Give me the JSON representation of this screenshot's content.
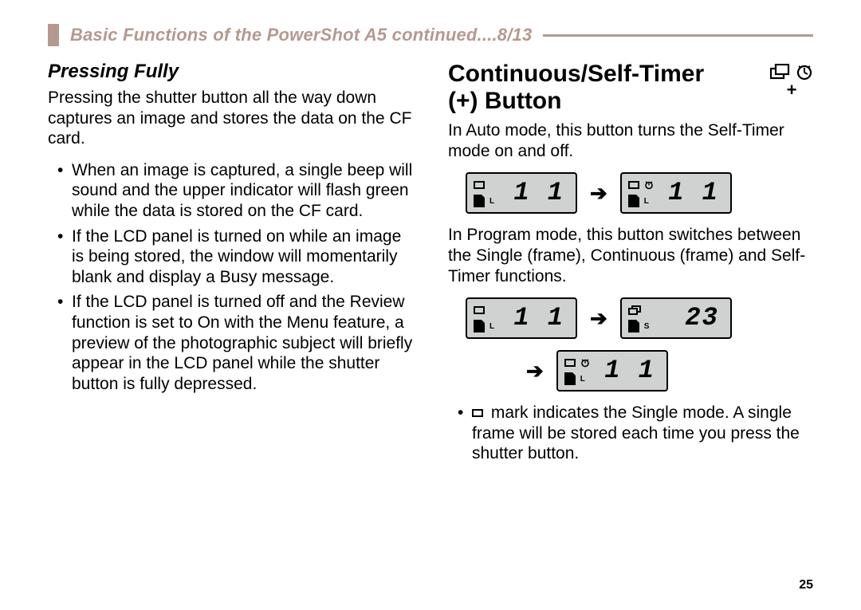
{
  "header": {
    "title": "Basic Functions of the PowerShot A5  continued....8/13"
  },
  "left": {
    "subhead": "Pressing Fully",
    "intro": "Pressing the shutter button all the way down captures an image and stores the data on the CF card.",
    "bullets": [
      "When an image is captured, a single beep will sound and the upper indicator will flash green while the data is stored on the CF card.",
      "If the LCD panel is turned on while an image is being stored, the window will momentarily blank and display a Busy message.",
      "If the LCD panel is turned off and the Review function is set to On with the Menu feature, a preview of the photographic subject will briefly appear in the LCD panel while the shutter button is fully depressed."
    ]
  },
  "right": {
    "title_line1": "Continuous/Self-Timer",
    "title_line2": "(+) Button",
    "plus": "+",
    "p1": "In Auto mode, this button turns the Self-Timer mode on and off.",
    "p2": "In Program mode, this button switches between the Single (frame), Continuous (frame) and Self-Timer functions.",
    "bullet_tail": " mark indicates the Single mode. A single frame will be stored each time you press the shutter button.",
    "lcd": {
      "arrow": "➔",
      "auto_before": {
        "top_letter": "L",
        "seg": "1 1"
      },
      "auto_after": {
        "top_letter": "L",
        "seg": "1 1"
      },
      "prog_a": {
        "top_letter": "L",
        "seg": "1 1"
      },
      "prog_b": {
        "bottom_letter": "S",
        "seg": "23"
      },
      "prog_c": {
        "top_letter": "L",
        "seg": "1 1"
      }
    }
  },
  "page_number": "25"
}
